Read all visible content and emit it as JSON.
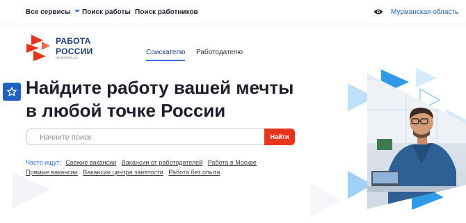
{
  "topbar": {
    "all_services": "Все сервисы",
    "job_search": "Поиск работы",
    "worker_search": "Поиск работников",
    "region": "Мурманская область"
  },
  "logo": {
    "line1": "РАБОТА",
    "line2": "РОССИИ",
    "domain": "trudvsem.ru"
  },
  "tabs": {
    "applicant": "Соискателю",
    "employer": "Работодателю"
  },
  "headline": {
    "line1": "Найдите работу вашей мечты",
    "line2": "в любой точке России"
  },
  "search": {
    "placeholder": "Начните поиск",
    "button": "Найти"
  },
  "popular": {
    "label": "Часто ищут:",
    "links": [
      "Свежие вакансии",
      "Вакансии от работодателей",
      "Работа в Москве",
      "Прямые вакансии",
      "Вакансии центра занятости",
      "Работа без опыта"
    ]
  },
  "colors": {
    "accent_blue": "#2f6ed6",
    "brand_navy": "#1f3a7a",
    "brand_red": "#e8341c"
  }
}
